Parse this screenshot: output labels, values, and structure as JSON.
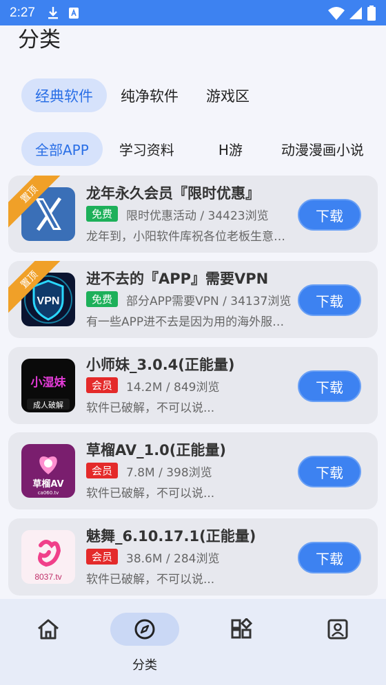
{
  "status_bar": {
    "time": "2:27"
  },
  "page_title": "分类",
  "category_tabs": [
    "经典软件",
    "纯净软件",
    "游戏区"
  ],
  "sub_tabs": [
    "全部APP",
    "学习资料",
    "H游",
    "动漫漫画小说"
  ],
  "apps": [
    {
      "title": "龙年永久会员『限时优惠』",
      "badge": "免费",
      "meta": "限时优惠活动 / 34423浏览",
      "desc": "龙年到，小阳软件库祝各位老板生意兴隆",
      "pinned": "置顶",
      "download": "下载",
      "icon_text": ""
    },
    {
      "title": "进不去的『APP』需要VPN",
      "badge": "免费",
      "meta": "部分APP需要VPN / 34137浏览",
      "desc": "有一些APP进不去是因为用的海外服务器",
      "pinned": "置顶",
      "download": "下载",
      "icon_text": "VPN"
    },
    {
      "title": "小师妹_3.0.4(正能量)",
      "badge": "会员",
      "meta": "14.2M / 849浏览",
      "desc": "软件已破解，不可以说...",
      "pinned": "",
      "download": "下载",
      "icon_text": "小湿妹",
      "icon_sub": "成人破解"
    },
    {
      "title": "草榴AV_1.0(正能量)",
      "badge": "会员",
      "meta": "7.8M / 398浏览",
      "desc": "软件已破解，不可以说...",
      "pinned": "",
      "download": "下载",
      "icon_text": "草榴AV",
      "icon_sub": "ca060.tv"
    },
    {
      "title": "魅舞_6.10.17.1(正能量)",
      "badge": "会员",
      "meta": "38.6M / 284浏览",
      "desc": "软件已破解，不可以说...",
      "pinned": "",
      "download": "下载",
      "icon_text": "8037.tv"
    }
  ],
  "bottom_nav": {
    "items": [
      {
        "icon": "home-icon",
        "label": ""
      },
      {
        "icon": "compass-icon",
        "label": "分类"
      },
      {
        "icon": "apps-grid-icon",
        "label": ""
      },
      {
        "icon": "profile-icon",
        "label": ""
      }
    ]
  },
  "colors": {
    "accent": "#3d82f1",
    "free_badge": "#1db05a",
    "vip_badge": "#e42a2a",
    "ribbon": "#f0a028"
  }
}
